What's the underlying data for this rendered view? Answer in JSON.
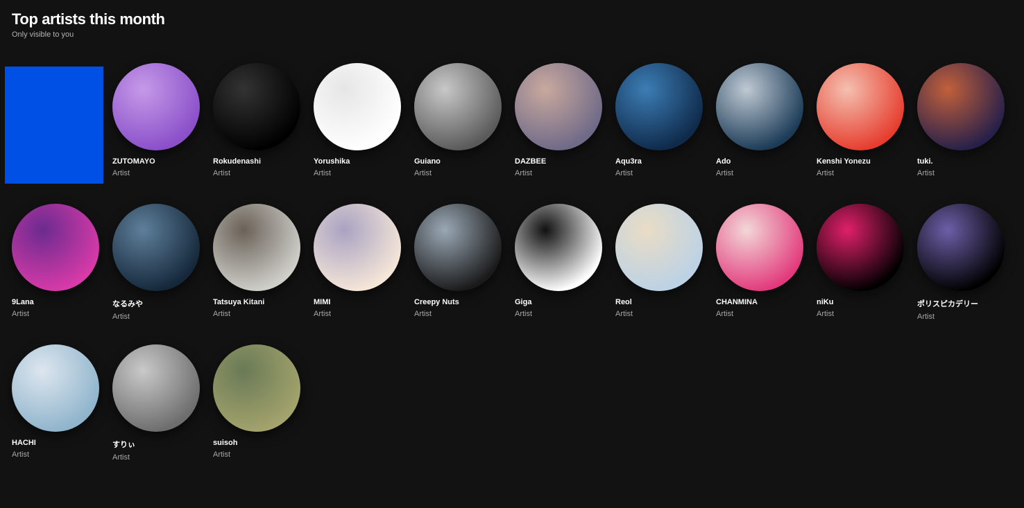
{
  "header": {
    "title": "Top artists this month",
    "subtitle": "Only visible to you"
  },
  "artists": [
    {
      "name": "",
      "role": "",
      "color": "#0050e6",
      "hidden": true
    },
    {
      "name": "ZUTOMAYO",
      "role": "Artist",
      "color": "#8a4fc9",
      "color2": "#c59ae8"
    },
    {
      "name": "Rokudenashi",
      "role": "Artist",
      "color": "#000000",
      "color2": "#333333"
    },
    {
      "name": "Yorushika",
      "role": "Artist",
      "color": "#ffffff",
      "color2": "#e6e6e6"
    },
    {
      "name": "Guiano",
      "role": "Artist",
      "color": "#5a5a5a",
      "color2": "#c8c8c8"
    },
    {
      "name": "DAZBEE",
      "role": "Artist",
      "color": "#6f6a88",
      "color2": "#c9a99e"
    },
    {
      "name": "Aqu3ra",
      "role": "Artist",
      "color": "#0f2a4a",
      "color2": "#3c7db5"
    },
    {
      "name": "Ado",
      "role": "Artist",
      "color": "#1b3b57",
      "color2": "#bfc9d3"
    },
    {
      "name": "Kenshi Yonezu",
      "role": "Artist",
      "color": "#e63d2e",
      "color2": "#f4c0b0"
    },
    {
      "name": "tuki.",
      "role": "Artist",
      "color": "#26204a",
      "color2": "#c2603b"
    },
    {
      "name": "9Lana",
      "role": "Artist",
      "color": "#d83aa8",
      "color2": "#6b2b8f"
    },
    {
      "name": "なるみや",
      "role": "Artist",
      "color": "#15283a",
      "color2": "#5e7f9b"
    },
    {
      "name": "Tatsuya Kitani",
      "role": "Artist",
      "color": "#cfcfca",
      "color2": "#6a6258"
    },
    {
      "name": "MIMI",
      "role": "Artist",
      "color": "#f5e6d8",
      "color2": "#a9a3c2"
    },
    {
      "name": "Creepy Nuts",
      "role": "Artist",
      "color": "#1a1a1a",
      "color2": "#9aa8b5"
    },
    {
      "name": "Giga",
      "role": "Artist",
      "color": "#ffffff",
      "color2": "#111111"
    },
    {
      "name": "Reol",
      "role": "Artist",
      "color": "#bcd2e6",
      "color2": "#e9dcc5"
    },
    {
      "name": "CHANMINA",
      "role": "Artist",
      "color": "#e23a7c",
      "color2": "#f2d7d7"
    },
    {
      "name": "niKu",
      "role": "Artist",
      "color": "#000000",
      "color2": "#e0206a"
    },
    {
      "name": "ポリスピカデリー",
      "role": "Artist",
      "color": "#000000",
      "color2": "#6d5fa8"
    },
    {
      "name": "HACHI",
      "role": "Artist",
      "color": "#8fb4cc",
      "color2": "#dde6ee"
    },
    {
      "name": "すりぃ",
      "role": "Artist",
      "color": "#6d6d6d",
      "color2": "#c9c9c9"
    },
    {
      "name": "suisoh",
      "role": "Artist",
      "color": "#a3a36c",
      "color2": "#6a7a56"
    }
  ]
}
